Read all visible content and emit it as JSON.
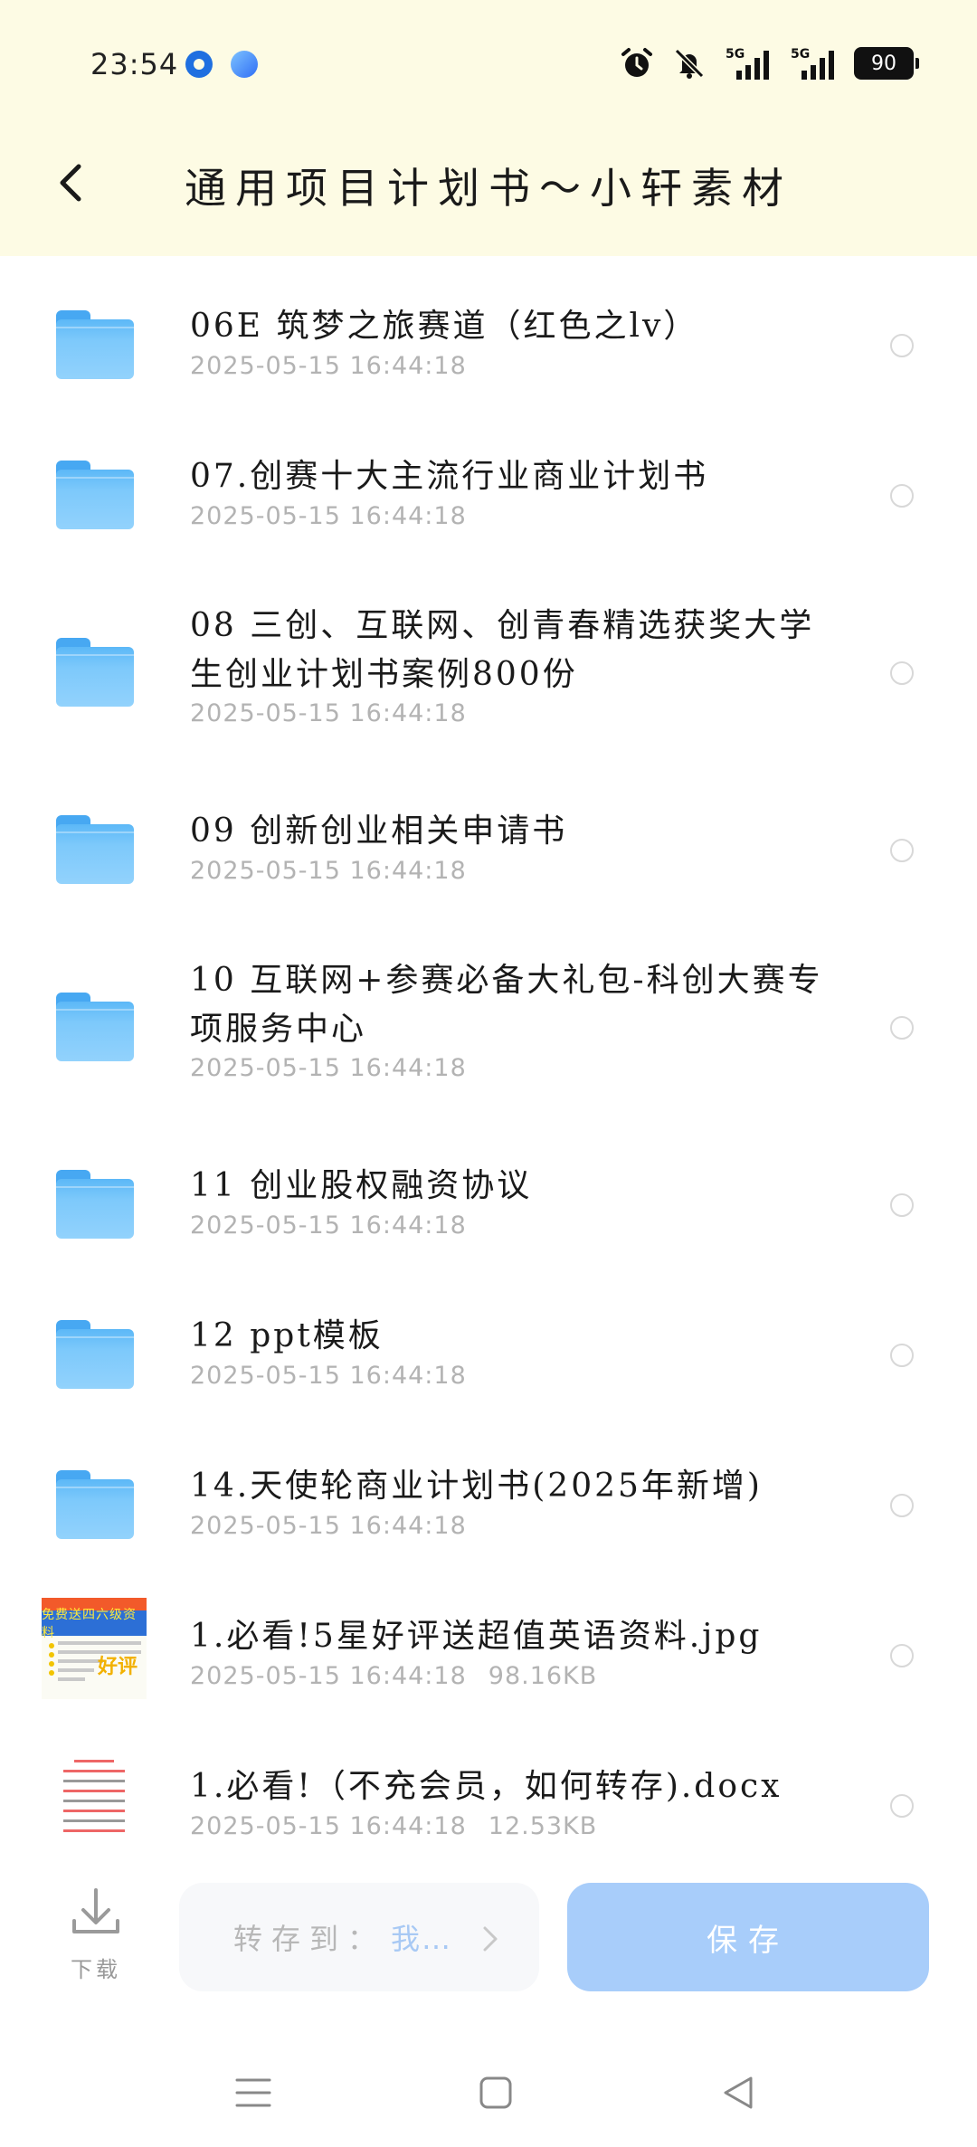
{
  "status_bar": {
    "time": "23:54",
    "battery": "90",
    "icons": [
      "app-icon-1",
      "app-icon-2",
      "alarm-icon",
      "mute-icon",
      "5g-signal-icon",
      "5g-signal-icon",
      "battery-icon"
    ]
  },
  "header": {
    "title": "通用项目计划书～小轩素材",
    "back_icon": "chevron-left-icon"
  },
  "files": [
    {
      "type": "folder",
      "name": "06E 筑梦之旅赛道（红色之lv）",
      "date": "2025-05-15 16:44:18",
      "size": ""
    },
    {
      "type": "folder",
      "name": "07.创赛十大主流行业商业计划书",
      "date": "2025-05-15 16:44:18",
      "size": ""
    },
    {
      "type": "folder",
      "name": "08 三创、互联网、创青春精选获奖大学生创业计划书案例800份",
      "date": "2025-05-15 16:44:18",
      "size": ""
    },
    {
      "type": "folder",
      "name": "09 创新创业相关申请书",
      "date": "2025-05-15 16:44:18",
      "size": ""
    },
    {
      "type": "folder",
      "name": "10 互联网+参赛必备大礼包-科创大赛专项服务中心",
      "date": "2025-05-15 16:44:18",
      "size": ""
    },
    {
      "type": "folder",
      "name": "11 创业股权融资协议",
      "date": "2025-05-15 16:44:18",
      "size": ""
    },
    {
      "type": "folder",
      "name": "12 ppt模板",
      "date": "2025-05-15 16:44:18",
      "size": ""
    },
    {
      "type": "folder",
      "name": "14.天使轮商业计划书(2025年新增)",
      "date": "2025-05-15 16:44:18",
      "size": ""
    },
    {
      "type": "jpg",
      "name": "1.必看!5星好评送超值英语资料.jpg",
      "date": "2025-05-15 16:44:18",
      "size": "98.16KB"
    },
    {
      "type": "docx",
      "name": "1.必看!（不充会员，如何转存).docx",
      "date": "2025-05-15 16:44:18",
      "size": "12.53KB"
    }
  ],
  "jpg_thumb": {
    "header": "免费送四六级资料",
    "badge": "好评"
  },
  "bottom": {
    "download_label": "下载",
    "save_to_label": "转存到：",
    "save_to_dest": "我…",
    "save_button": "保存"
  },
  "colors": {
    "header_bg": "#fdfbe4",
    "folder": "#5cb8f7",
    "save_button": "#a8cdfa",
    "date_text": "#b3b3b3"
  }
}
